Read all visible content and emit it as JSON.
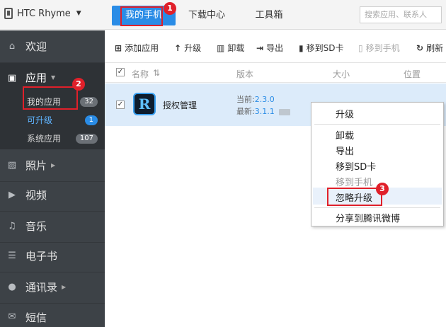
{
  "topbar": {
    "device_name": "HTC Rhyme",
    "tabs": [
      "我的手机",
      "下载中心",
      "工具箱"
    ],
    "search_placeholder": "搜索应用、联系人"
  },
  "sidebar": {
    "welcome": "欢迎",
    "apps": {
      "label": "应用",
      "items": [
        {
          "label": "我的应用",
          "count": "32"
        },
        {
          "label": "可升级",
          "count": "1"
        },
        {
          "label": "系统应用",
          "count": "107"
        }
      ]
    },
    "photos": "照片",
    "video": "视频",
    "music": "音乐",
    "ebooks": "电子书",
    "contacts": "通讯录",
    "sms": "短信"
  },
  "toolbar": {
    "add_app": "添加应用",
    "upgrade": "升级",
    "uninstall": "卸载",
    "export": "导出",
    "move_to_sd": "移到SD卡",
    "move_to_phone": "移到手机",
    "refresh": "刷新"
  },
  "table": {
    "columns": [
      "名称",
      "版本",
      "大小",
      "位置"
    ],
    "rows": [
      {
        "name": "授权管理",
        "current_version_label": "当前:",
        "current_version": "2.3.0",
        "latest_version_label": "最新:",
        "latest_version": "3.1.1"
      }
    ]
  },
  "context_menu": {
    "items": [
      "升级",
      "卸载",
      "导出",
      "移到SD卡",
      "移到手机",
      "忽略升级",
      "分享到腾讯微博"
    ]
  },
  "annotations": {
    "markers": [
      "1",
      "2",
      "3"
    ],
    "color": "#e0202a"
  },
  "colors": {
    "accent": "#2a8ce6",
    "sidebar_bg": "#3d4247",
    "row_selected": "#dcebfa"
  }
}
